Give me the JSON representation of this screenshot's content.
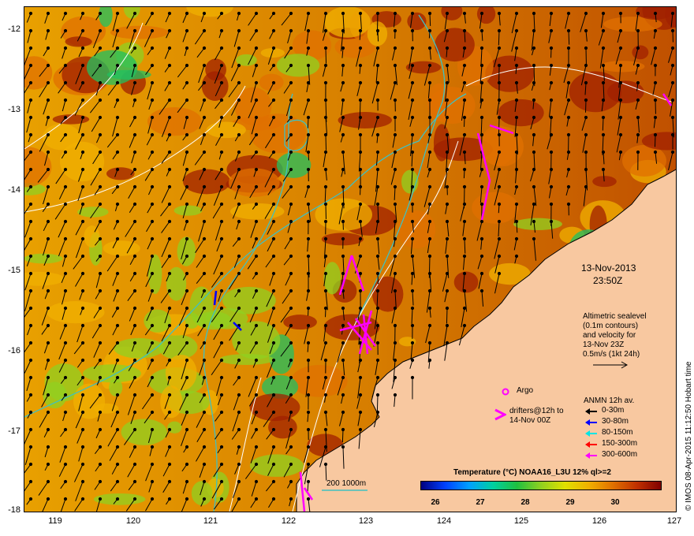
{
  "map": {
    "date": "13-Nov-2013",
    "time": "23:50Z",
    "lon_ticks": [
      "119",
      "120",
      "121",
      "122",
      "123",
      "124",
      "125",
      "126",
      "127"
    ],
    "lat_ticks": [
      "-12",
      "-13",
      "-14",
      "-15",
      "-16",
      "-17",
      "-18"
    ],
    "lon_range": [
      118.6,
      127
    ],
    "lat_range": [
      -11.7,
      -18
    ],
    "credit": "© IMOS 08-Apr-2015 11:12:50 Hobart time"
  },
  "altimetry_note": {
    "line1": "Altimetric sealevel",
    "line2": "(0.1m contours)",
    "line3": "and velocity for",
    "line4": "13-Nov 23Z",
    "line5": "0.5m/s (1kt 24h)"
  },
  "legend": {
    "argo": "Argo",
    "drifters_1": "drifters@12h to",
    "drifters_2": "14-Nov 00Z",
    "anmn_title": "ANMN 12h av.",
    "depths": [
      {
        "label": "0-30m",
        "color": "#000000"
      },
      {
        "label": "30-80m",
        "color": "#0000ff"
      },
      {
        "label": "80-150m",
        "color": "#00e5e5"
      },
      {
        "label": "150-300m",
        "color": "#ff0000"
      },
      {
        "label": "300-600m",
        "color": "#ff00ff"
      }
    ],
    "isobaths": "200  1000m"
  },
  "colorbar": {
    "title": "Temperature (°C) NOAA16_L3U 12% ql>=2",
    "ticks": [
      "26",
      "27",
      "28",
      "29",
      "30"
    ]
  },
  "colors": {
    "land": "#f8c8a0",
    "hot": "#a02000",
    "warm": "#e07000",
    "mid": "#f0b000",
    "cool": "#90d020",
    "cold": "#20c060",
    "bathy": "#40c0c0",
    "drifter": "#ff00ff"
  }
}
